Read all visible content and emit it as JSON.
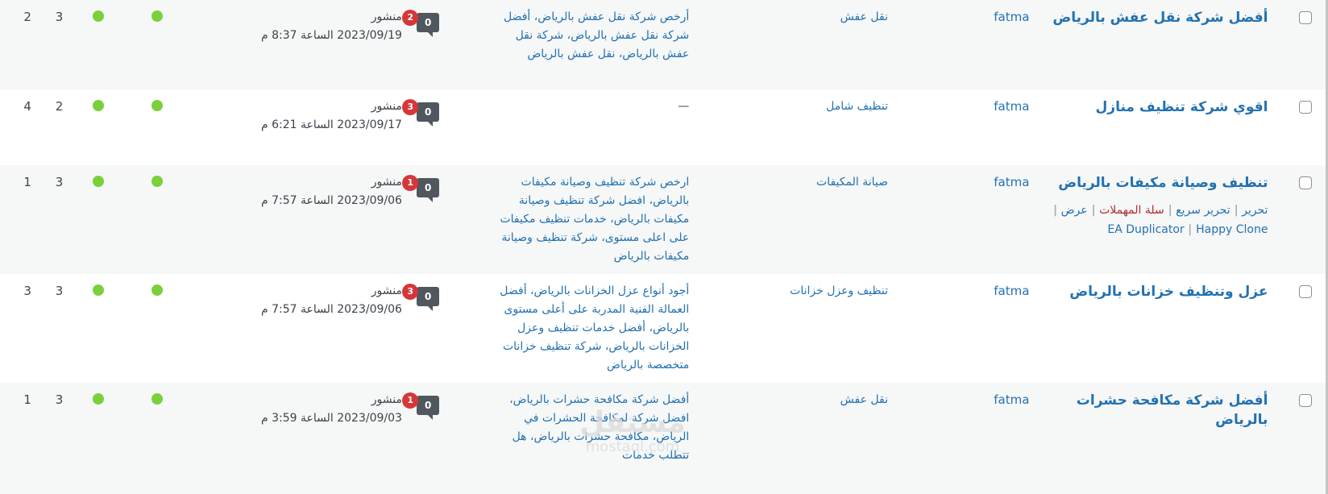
{
  "rows": [
    {
      "title": "أفضل شركة نقل عفش بالرياض",
      "author": "fatma",
      "category": "نقل عفش",
      "tags": "أرخص شركة نقل عفش بالرياض، أفضل شركة نقل عفش بالرياض، شركة نقل عفش بالرياض، نقل عفش بالرياض",
      "comments": "0",
      "pending": "2",
      "status": "منشور",
      "date": "2023/09/19 الساعة 8:37 م",
      "n1": "3",
      "n2": "2"
    },
    {
      "title": "اقوي شركة تنظيف منازل",
      "author": "fatma",
      "category": "تنظيف شامل",
      "tags": "—",
      "comments": "0",
      "pending": "3",
      "status": "منشور",
      "date": "2023/09/17 الساعة 6:21 م",
      "n1": "2",
      "n2": "4"
    },
    {
      "title": "تنظيف وصيانة مكيفات بالرياض",
      "author": "fatma",
      "category": "صيانة المكيفات",
      "tags": "ارخص شركة تنظيف وصيانة مكيفات بالرياض، افضل شركة تنظيف وصيانة مكيفات بالرياض، خدمات تنظيف مكيفات على اعلى مستوى، شركة تنظيف وصيانة مكيفات بالرياض",
      "comments": "0",
      "pending": "1",
      "status": "منشور",
      "date": "2023/09/06 الساعة 7:57 م",
      "n1": "3",
      "n2": "1",
      "row_actions": {
        "edit": "تحرير",
        "quick_edit": "تحرير سريع",
        "trash": "سلة المهملات",
        "view": "عرض",
        "ea_duplicator": "EA Duplicator",
        "happy_clone": "Happy Clone"
      }
    },
    {
      "title": "عزل وتنظيف خزانات بالرياض",
      "author": "fatma",
      "category": "تنظيف وعزل خزانات",
      "tags": "أجود أنواع عزل الخزانات بالرياض، أفضل العمالة الفنية المدربة على أعلى مستوى بالرياض، أفضل خدمات تنظيف وعزل الخزانات بالرياض، شركة تنظيف خزانات متخصصة بالرياض",
      "comments": "0",
      "pending": "3",
      "status": "منشور",
      "date": "2023/09/06 الساعة 7:57 م",
      "n1": "3",
      "n2": "3"
    },
    {
      "title": "أفضل شركة مكافحة حشرات بالرياض",
      "author": "fatma",
      "category": "نقل عفش",
      "tags": "أفضل شركة مكافحة حشرات بالرياض، افضل شركة لمكافحة الحشرات في الرياض، مكافحة حشرات بالرياض، هل تتطلب خدمات",
      "comments": "0",
      "pending": "1",
      "status": "منشور",
      "date": "2023/09/03 الساعة 3:59 م",
      "n1": "3",
      "n2": "1"
    }
  ],
  "watermark": {
    "arabic": "مستقل",
    "latin": "mostaql.com"
  },
  "colors": {
    "link": "#2271b1",
    "trash": "#b32d2e",
    "pending_badge": "#d63638",
    "status_dot": "#7ad03a",
    "alt_row": "#f6f7f7"
  }
}
